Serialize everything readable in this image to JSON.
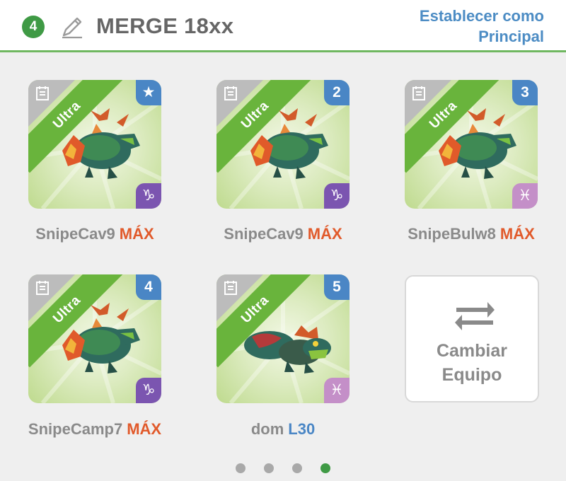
{
  "header": {
    "team_number": "4",
    "team_name": "MERGE 18xx",
    "set_main_line1": "Establecer como",
    "set_main_line2": "Principal"
  },
  "cards": [
    {
      "rarity": "Ultra",
      "corner": "star",
      "sign": "♑",
      "sign_color": "purple",
      "name": "SnipeCav9",
      "tag": "MÁX",
      "tag_kind": "max"
    },
    {
      "rarity": "Ultra",
      "corner": "2",
      "sign": "♑",
      "sign_color": "purple",
      "name": "SnipeCav9",
      "tag": "MÁX",
      "tag_kind": "max"
    },
    {
      "rarity": "Ultra",
      "corner": "3",
      "sign": "♓",
      "sign_color": "pink",
      "name": "SnipeBulw8",
      "tag": "MÁX",
      "tag_kind": "max"
    },
    {
      "rarity": "Ultra",
      "corner": "4",
      "sign": "♑",
      "sign_color": "purple",
      "name": "SnipeCamp7",
      "tag": "MÁX",
      "tag_kind": "max"
    },
    {
      "rarity": "Ultra",
      "corner": "5",
      "sign": "♓",
      "sign_color": "pink",
      "name": "dom",
      "tag": "L30",
      "tag_kind": "level"
    }
  ],
  "change_team": {
    "line1": "Cambiar",
    "line2": "Equipo"
  },
  "pager": {
    "pages": 4,
    "active_index": 3
  },
  "colors": {
    "accent_green": "#3f9a45",
    "link_blue": "#4a86c5",
    "max_orange": "#e15a2b"
  }
}
